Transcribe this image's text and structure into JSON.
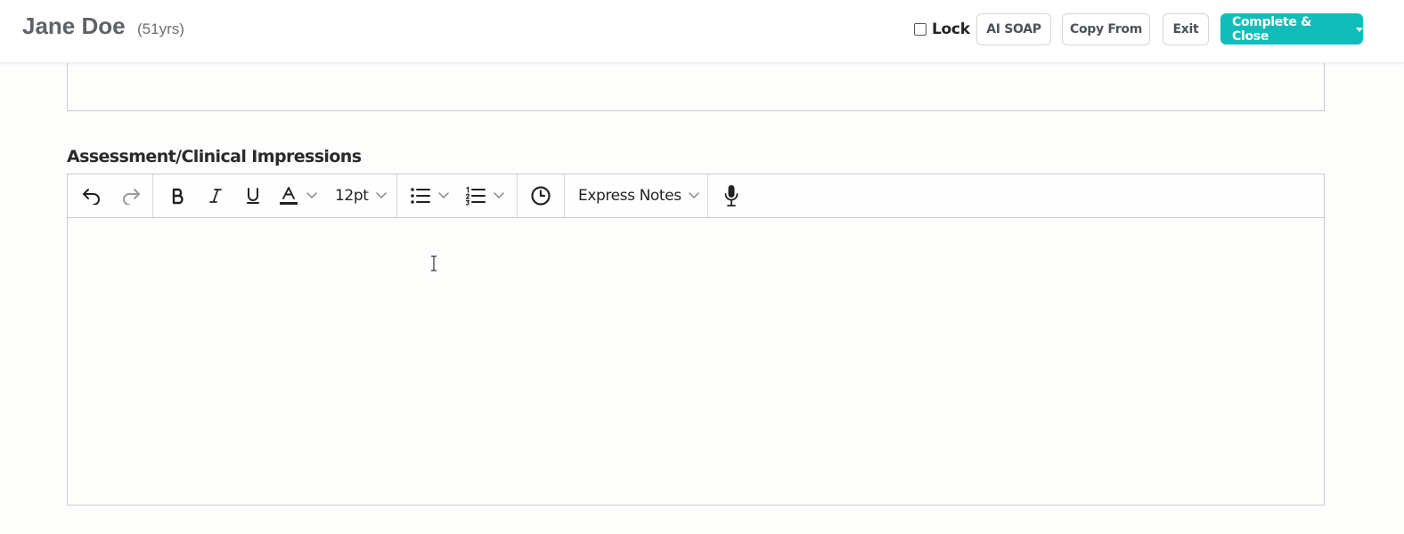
{
  "header": {
    "patient_name": "Jane Doe",
    "patient_age": "(51yrs)",
    "lock_label": "Lock",
    "lock_checked": false,
    "ai_soap_label": "AI SOAP",
    "copy_from_label": "Copy From",
    "exit_label": "Exit",
    "complete_close_label": "Complete & Close",
    "accent_color": "#12bdb9"
  },
  "section": {
    "title": "Assessment/Clinical Impressions"
  },
  "toolbar": {
    "undo_icon": "undo-icon",
    "redo_icon": "redo-icon",
    "bold_icon": "bold-icon",
    "italic_icon": "italic-icon",
    "underline_icon": "underline-icon",
    "text_color_icon": "text-color-icon",
    "font_size": "12pt",
    "bullet_list_icon": "bullet-list-icon",
    "numbered_list_icon": "numbered-list-icon",
    "clock_icon": "clock-icon",
    "express_notes_label": "Express Notes",
    "microphone_icon": "microphone-icon"
  },
  "editor": {
    "content": ""
  }
}
